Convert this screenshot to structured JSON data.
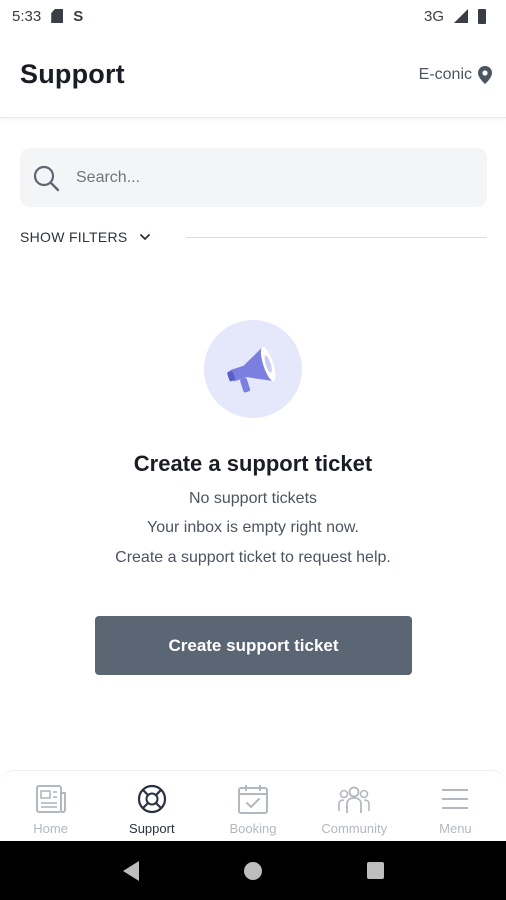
{
  "status_bar": {
    "time": "5:33",
    "network": "3G"
  },
  "header": {
    "title": "Support",
    "location": "E-conic"
  },
  "search": {
    "placeholder": "Search..."
  },
  "filters": {
    "label": "SHOW FILTERS"
  },
  "empty_state": {
    "title": "Create a support ticket",
    "line1": "No support tickets",
    "line2": "Your inbox is empty right now.",
    "line3": "Create a support ticket to request help."
  },
  "actions": {
    "create_label": "Create support ticket"
  },
  "bottom_nav": {
    "items": [
      {
        "label": "Home",
        "icon": "news-icon",
        "active": false
      },
      {
        "label": "Support",
        "icon": "lifebuoy-icon",
        "active": true
      },
      {
        "label": "Booking",
        "icon": "calendar-icon",
        "active": false
      },
      {
        "label": "Community",
        "icon": "people-icon",
        "active": false
      },
      {
        "label": "Menu",
        "icon": "menu-icon",
        "active": false
      }
    ]
  },
  "colors": {
    "primary_button": "#5a6673",
    "empty_icon_bg": "#e5e7fb",
    "accent_purple": "#7b80e0",
    "active_nav": "#2a3140",
    "inactive_nav": "#b3b8c0"
  }
}
